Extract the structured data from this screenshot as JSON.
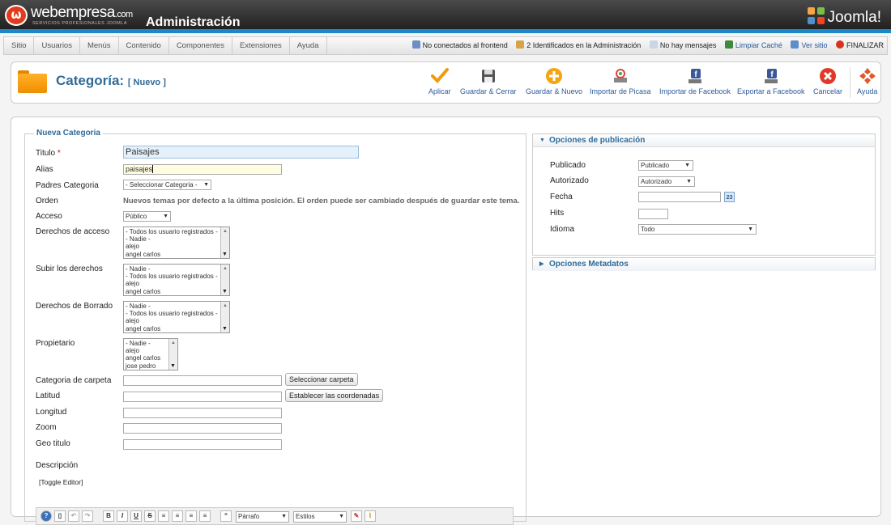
{
  "header": {
    "logo_text": "webempresa",
    "logo_suffix": ".com",
    "logo_tagline": "SERVICIOS PROFESIONALES JOOMLA",
    "title": "Administración",
    "joomla_logo": "Joomla!"
  },
  "menubar": {
    "items": [
      "Sitio",
      "Usuarios",
      "Menús",
      "Contenido",
      "Componentes",
      "Extensiones",
      "Ayuda"
    ]
  },
  "status": {
    "frontend": "No conectados al frontend",
    "admins": "2 Identificados en la Administración",
    "messages": "No hay mensajes",
    "clear_cache": "Limpiar Caché",
    "view_site": "Ver sitio",
    "logout": "FINALIZAR"
  },
  "toolbar": {
    "title": "Categoría:",
    "subtitle": "[ Nuevo ]",
    "buttons": [
      {
        "label": "Aplicar",
        "icon": "check-icon"
      },
      {
        "label": "Guardar & Cerrar",
        "icon": "floppy-disk-icon"
      },
      {
        "label": "Guardar & Nuevo",
        "icon": "plus-circle-icon"
      },
      {
        "label": "Importar de Picasa",
        "icon": "picasa-icon"
      },
      {
        "label": "Importar de Facebook",
        "icon": "facebook-import-icon"
      },
      {
        "label": "Exportar a Facebook",
        "icon": "facebook-export-icon"
      },
      {
        "label": "Cancelar",
        "icon": "cancel-icon"
      },
      {
        "label": "Ayuda",
        "icon": "help-lifebuoy-icon"
      }
    ]
  },
  "form": {
    "legend": "Nueva Categoria",
    "titulo_label": "Titulo",
    "required_mark": "*",
    "titulo_value": "Paisajes",
    "alias_label": "Alias",
    "alias_value": "paisajes",
    "padres_label": "Padres Categoria",
    "padres_value": "- Seleccionar Categoria -",
    "orden_label": "Orden",
    "orden_text": "Nuevos temas por defecto a la última posición. El orden puede ser cambiado después de guardar este tema.",
    "acceso_label": "Acceso",
    "acceso_value": "Público",
    "derechos_acceso_label": "Derechos de acceso",
    "derechos_acceso_items": [
      "- Todos los usuario registrados -",
      "- Nadie -",
      "alejo",
      "angel carlos"
    ],
    "subir_label": "Subir los derechos",
    "subir_items": [
      "- Nadie -",
      "- Todos los usuario registrados -",
      "alejo",
      "angel carlos"
    ],
    "borrado_label": "Derechos de Borrado",
    "borrado_items": [
      "- Nadie -",
      "- Todos los usuario registrados -",
      "alejo",
      "angel carlos"
    ],
    "propietario_label": "Propietario",
    "propietario_items": [
      "- Nadie -",
      "alejo",
      "angel carlos",
      "jose pedro"
    ],
    "carpeta_label": "Categoria de carpeta",
    "carpeta_button": "Seleccionar carpeta",
    "latitud_label": "Latitud",
    "coords_button": "Establecer las coordenadas",
    "longitud_label": "Longitud",
    "zoom_label": "Zoom",
    "geo_label": "Geo titulo",
    "descripcion_label": "Descripción",
    "toggle_editor": "[Toggle Editor]",
    "editor_format": "Párrafo",
    "editor_styles": "Estilos"
  },
  "publicacion": {
    "header": "Opciones de publicación",
    "publicado_label": "Publicado",
    "publicado_value": "Publicado",
    "autorizado_label": "Autorizado",
    "autorizado_value": "Autorizado",
    "fecha_label": "Fecha",
    "hits_label": "Hits",
    "idioma_label": "Idioma",
    "idioma_value": "Todo"
  },
  "metadatos": {
    "header": "Opciones Metadatos"
  }
}
